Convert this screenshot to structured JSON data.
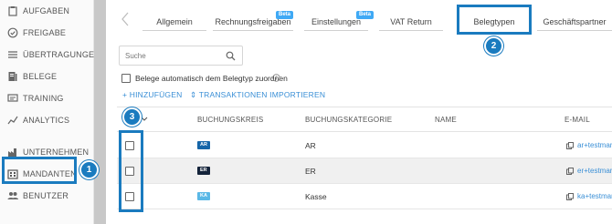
{
  "sidebar": {
    "items": [
      {
        "label": "AUFGABEN",
        "icon": "clipboard-icon"
      },
      {
        "label": "FREIGABE",
        "icon": "check-circle-icon"
      },
      {
        "label": "ÜBERTRAGUNGEN",
        "icon": "list-icon"
      },
      {
        "label": "BELEGE",
        "icon": "document-icon"
      },
      {
        "label": "TRAINING",
        "icon": "training-icon"
      },
      {
        "label": "ANALYTICS",
        "icon": "analytics-icon"
      },
      {
        "label": "UNTERNEHMEN",
        "icon": "factory-icon"
      },
      {
        "label": "MANDANTEN",
        "icon": "building-icon"
      },
      {
        "label": "BENUTZER",
        "icon": "users-icon"
      }
    ]
  },
  "tabs": [
    {
      "label": "Allgemein"
    },
    {
      "label": "Rechnungsfreigaben",
      "badge": "Beta"
    },
    {
      "label": "Einstellungen",
      "badge": "Beta"
    },
    {
      "label": "VAT Return"
    },
    {
      "label": "Belegtypen",
      "active": true
    },
    {
      "label": "Geschäftspartner"
    }
  ],
  "search": {
    "placeholder": "Suche"
  },
  "auto_assign": {
    "label": "Belege automatisch dem Belegtyp zuordnen",
    "checked": false
  },
  "actions": {
    "add": "+  HINZUFÜGEN",
    "import": "⇕  TRANSAKTIONEN IMPORTIEREN"
  },
  "table": {
    "headers": {
      "buchungskreis": "BUCHUNGSKREIS",
      "buchungskategorie": "BUCHUNGSKATEGORIE",
      "name": "NAME",
      "email": "E-MAIL"
    },
    "rows": [
      {
        "buchungskreis": "AR",
        "tag_color": "#1565a8",
        "buchungskategorie": "AR",
        "name": "",
        "email": "ar+testman",
        "checked": false
      },
      {
        "buchungskreis": "ER",
        "tag_color": "#14233a",
        "buchungskategorie": "ER",
        "name": "",
        "email": "er+testman",
        "checked": false
      },
      {
        "buchungskreis": "KA",
        "tag_color": "#5ab8e6",
        "buchungskategorie": "Kasse",
        "name": "",
        "email": "ka+testman",
        "checked": false
      }
    ]
  },
  "callouts": {
    "one": "1",
    "two": "2",
    "three": "3"
  },
  "colors": {
    "accent": "#3a8fd6",
    "callout": "#1a7bbf",
    "beta": "#3fa9f5"
  }
}
